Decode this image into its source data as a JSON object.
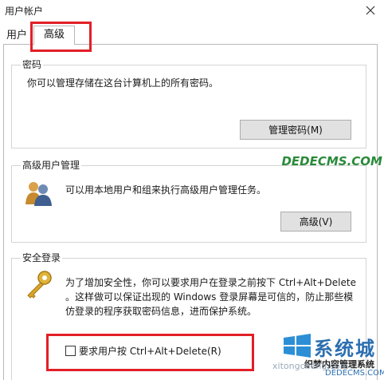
{
  "window": {
    "title": "用户帐户"
  },
  "tabs": {
    "user_label": "用户",
    "advanced_label": "高级"
  },
  "passwords": {
    "heading": "密码",
    "description": "你可以管理存储在这台计算机上的所有密码。",
    "manage_button": "管理密码(M)"
  },
  "advanced_user_mgmt": {
    "heading": "高级用户管理",
    "description": "可以用本地用户和组来执行高级用户管理任务。",
    "advanced_button": "高级(V)"
  },
  "secure_logon": {
    "heading": "安全登录",
    "description_line1": "为了增加安全性，你可以要求用户在登录之前按下 Ctrl+Alt+Delete",
    "description_line2": "。这样做可以保证出现的 Windows 登录屏幕是可信的，防止那些模",
    "description_line3": "仿登录的程序获取密码信息，进而保护系统。",
    "checkbox_label": "要求用户按 Ctrl+Alt+Delete(R)",
    "checkbox_checked": false
  },
  "watermark": {
    "brand_top": "系统城",
    "brand_cn": "织梦内容管理系统",
    "brand_url": "DEDECMS.COM",
    "dede_text": "DEDECMS.COM",
    "site_text": "xitongcheng.com"
  },
  "colors": {
    "highlight": "#e21f26",
    "button_bg": "#e1e1e1",
    "group_border": "#d4d4d4"
  }
}
